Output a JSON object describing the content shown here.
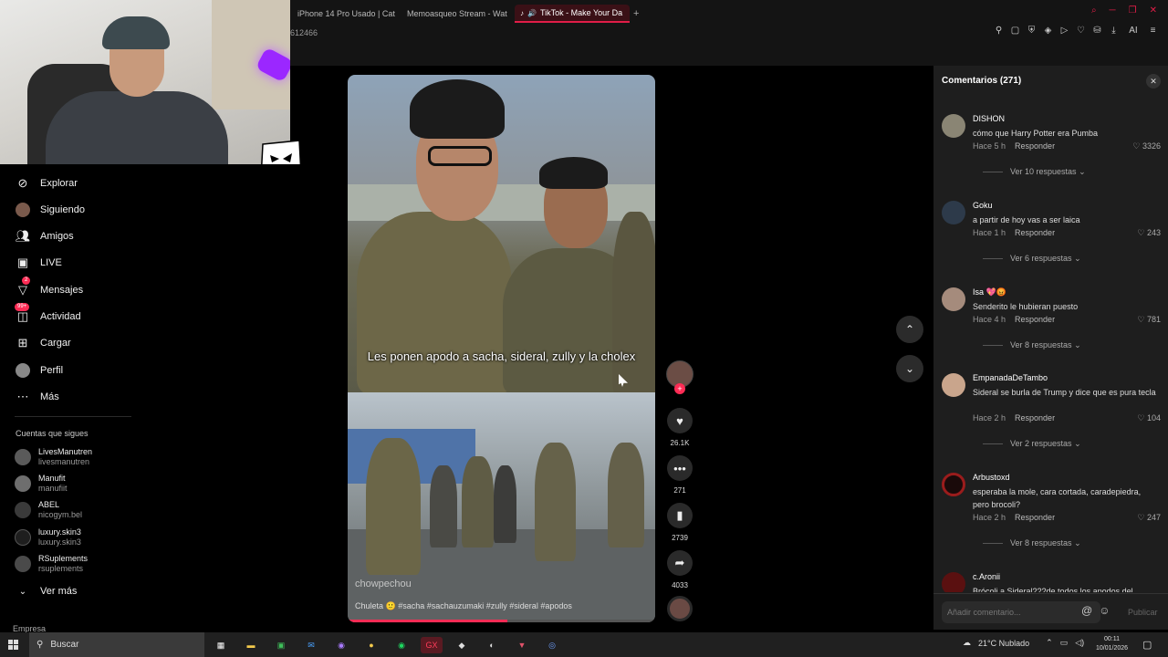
{
  "browser": {
    "tabs": [
      {
        "title": "iPhone 14 Pro Usado | Cat",
        "favicon_color": "#f2a900"
      },
      {
        "title": "Memoasqueo Stream - Wat",
        "favicon_color": "#53fc18"
      },
      {
        "title": "TikTok - Make Your Da",
        "favicon_color": "#ffffff",
        "active": true
      }
    ],
    "new_tab_icon": "plus-icon",
    "url_fragment": "612466",
    "accent_color": "#e11d48",
    "ai_label": "AI"
  },
  "sidebar": {
    "nav": [
      {
        "label": "Explorar",
        "icon": "compass-icon"
      },
      {
        "label": "Siguiendo",
        "icon": "following-avatar-icon"
      },
      {
        "label": "Amigos",
        "icon": "friends-icon"
      },
      {
        "label": "LIVE",
        "icon": "live-icon"
      },
      {
        "label": "Mensajes",
        "icon": "messages-icon",
        "badge": "2"
      },
      {
        "label": "Actividad",
        "icon": "activity-icon",
        "badge": "99+"
      },
      {
        "label": "Cargar",
        "icon": "upload-icon"
      },
      {
        "label": "Perfil",
        "icon": "profile-avatar-icon"
      },
      {
        "label": "Más",
        "icon": "more-dots-icon"
      }
    ],
    "following_title": "Cuentas que sigues",
    "following": [
      {
        "name": "LivesManutren",
        "handle": "livesmanutren"
      },
      {
        "name": "Manufit",
        "handle": "manufiit"
      },
      {
        "name": "ABEL",
        "handle": "nicogym.bel"
      },
      {
        "name": "luxury.skin3",
        "handle": "luxury.skin3"
      },
      {
        "name": "RSuplements",
        "handle": "rsuplements"
      }
    ],
    "see_more": "Ver más",
    "footer": "Empresa"
  },
  "video": {
    "caption": "Les ponen apodo a sacha, sideral, zully y la cholex",
    "watermark": "chowpechou",
    "description": "Chuleta 🙂 #sacha #sachauzumaki #zully #sideral #apodos",
    "progress": 0.52
  },
  "actions": {
    "likes": "26.1K",
    "comments": "271",
    "saves": "2739",
    "shares": "4033"
  },
  "comments_panel": {
    "title": "Comentarios (271)",
    "input_placeholder": "Añadir comentario...",
    "publish": "Publicar",
    "reply_label": "Responder",
    "items": [
      {
        "user": "DISHON",
        "text": "cómo que Harry Potter era Pumba",
        "time": "Hace 5 h",
        "likes": "3326",
        "more": "Ver 10 respuestas"
      },
      {
        "user": "Goku",
        "text": "a partir de hoy vas a ser laica",
        "time": "Hace 1 h",
        "likes": "243",
        "more": "Ver 6 respuestas"
      },
      {
        "user": "Isa 💖😡",
        "text": "Senderito le hubieran puesto",
        "time": "Hace 4 h",
        "likes": "781",
        "more": "Ver 8 respuestas"
      },
      {
        "user": "EmpanadaDeTambo",
        "text": "Sideral se burla de Trump y dice que es pura tecla",
        "time": "Hace 2 h",
        "likes": "104",
        "more": "Ver 2 respuestas"
      },
      {
        "user": "Arbustoxd",
        "text": "esperaba la mole, cara cortada, caradepiedra, pero brocoli?",
        "time": "Hace 2 h",
        "likes": "247",
        "more": "Ver 8 respuestas"
      },
      {
        "user": "c.Aronii",
        "text": "Brócoli a Sideral???de todos los apodos del",
        "time": "",
        "likes": "",
        "more": ""
      }
    ]
  },
  "taskbar": {
    "search": "Buscar",
    "weather": "21°C  Nublado",
    "time": "00:11",
    "date": "10/01/2026"
  }
}
